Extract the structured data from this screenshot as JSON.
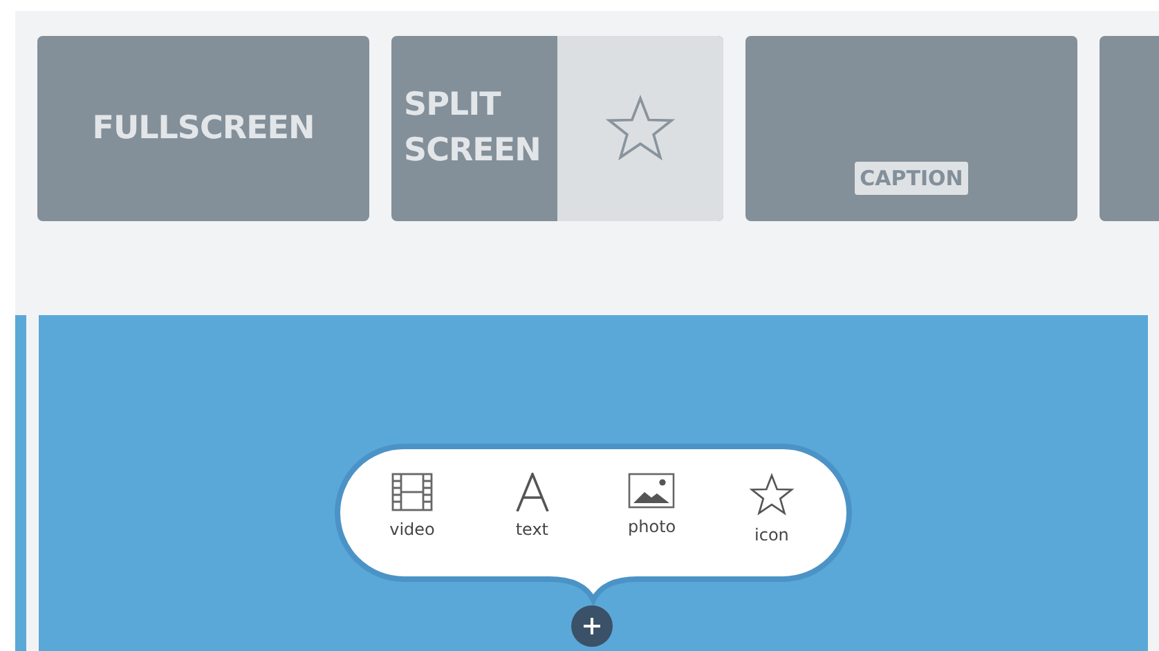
{
  "layouts": [
    {
      "kind": "fullscreen",
      "label": "FULLSCREEN"
    },
    {
      "kind": "split",
      "label": "SPLIT SCREEN"
    },
    {
      "kind": "caption",
      "label": "CAPTION"
    },
    {
      "kind": "blank"
    }
  ],
  "add_menu": {
    "items": [
      {
        "kind": "video",
        "label": "video"
      },
      {
        "kind": "text",
        "label": "text"
      },
      {
        "kind": "photo",
        "label": "photo"
      },
      {
        "kind": "icon",
        "label": "icon"
      }
    ]
  }
}
